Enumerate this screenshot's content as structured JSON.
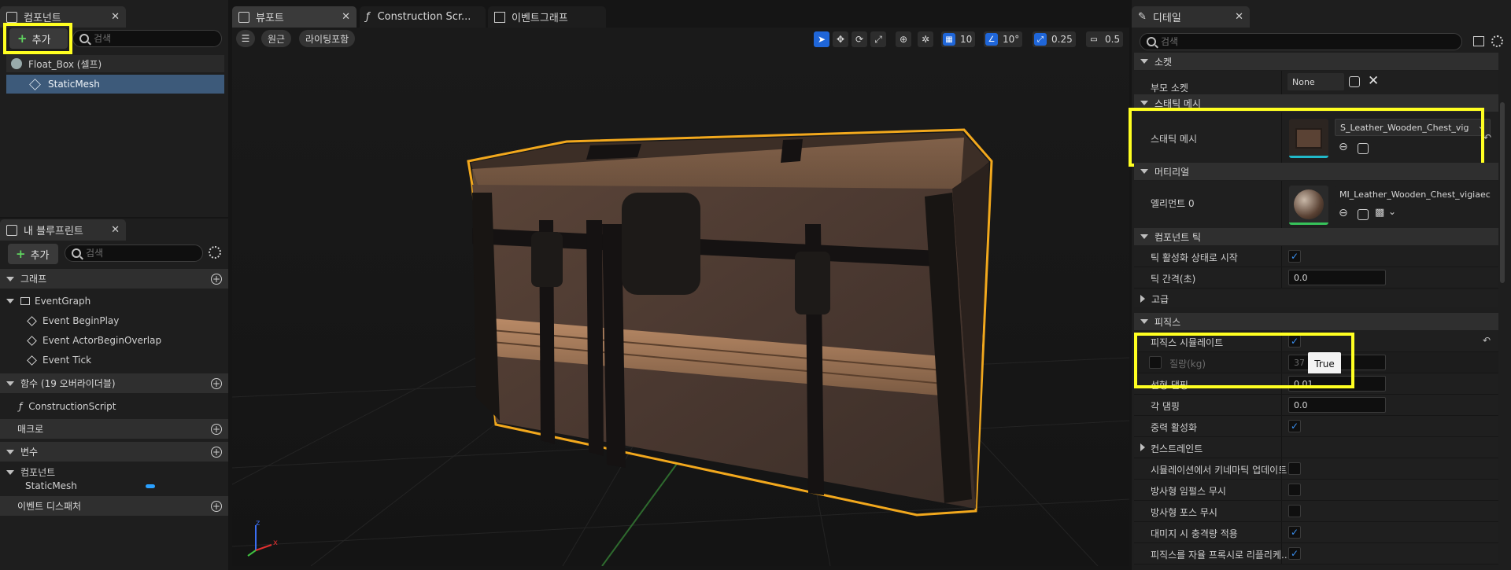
{
  "left_panel": {
    "components_tab": "컴포넌트",
    "add_label": "추가",
    "search_placeholder": "검색",
    "root_item": "Float_Box (셀프)",
    "child_item": "StaticMesh"
  },
  "blueprint_panel": {
    "tab": "내 블루프린트",
    "add_label": "추가",
    "search_placeholder": "검색",
    "graph_section": "그래프",
    "event_graph": "EventGraph",
    "events": [
      "Event BeginPlay",
      "Event ActorBeginOverlap",
      "Event Tick"
    ],
    "functions_section": "함수 (19 오버라이더블)",
    "construction_script": "ConstructionScript",
    "macros_section": "매크로",
    "variables_section": "변수",
    "components_group": "컴포넌트",
    "static_mesh_var": "StaticMesh",
    "dispatchers_section": "이벤트 디스패처"
  },
  "viewport": {
    "tabs": [
      "뷰포트",
      "Construction Scr...",
      "이벤트그래프"
    ],
    "perspective_btn": "원근",
    "lighting_btn": "라이팅포함",
    "grid_snap": "10",
    "rotation_snap": "10°",
    "scale_snap": "0.25",
    "camera_speed": "0.5",
    "axis_x": "x",
    "axis_z": "z"
  },
  "details": {
    "tab": "디테일",
    "search_placeholder": "검색",
    "socket_section": "소켓",
    "parent_socket_label": "부모 소켓",
    "parent_socket_value": "None",
    "static_mesh_section": "스태틱 메시",
    "static_mesh_label": "스태틱 메시",
    "static_mesh_value": "S_Leather_Wooden_Chest_vig",
    "materials_section": "머티리얼",
    "element0_label": "엘리먼트 0",
    "element0_value": "MI_Leather_Wooden_Chest_vigiaec",
    "component_tick_section": "컴포넌트 틱",
    "start_tick_label": "틱 활성화 상태로 시작",
    "tick_interval_label": "틱 간격(초)",
    "tick_interval_value": "0.0",
    "advanced_section": "고급",
    "physics_section": "피직스",
    "simulate_physics_label": "피직스 시뮬레이트",
    "mass_label": "질량(kg)",
    "mass_value": "37",
    "tooltip": "True",
    "linear_damping_label": "선형 댐핑",
    "linear_damping_value": "0.01",
    "angular_damping_label": "각 댐핑",
    "angular_damping_value": "0.0",
    "gravity_label": "중력 활성화",
    "constraints_section": "컨스트레인트",
    "kinematic_label": "시뮬레이션에서 키네마틱 업데이트",
    "radial_impulse_label": "방사형 임펄스 무시",
    "radial_force_label": "방사형 포스 무시",
    "damage_impulse_label": "대미지 시 충격량 적용",
    "replicate_physics_label": "피직스를 자율 프록시로 리플리케..."
  },
  "colors": {
    "highlight": "#ffff21",
    "accent_blue": "#1f66d9",
    "selection_outline": "#f2a81d"
  }
}
